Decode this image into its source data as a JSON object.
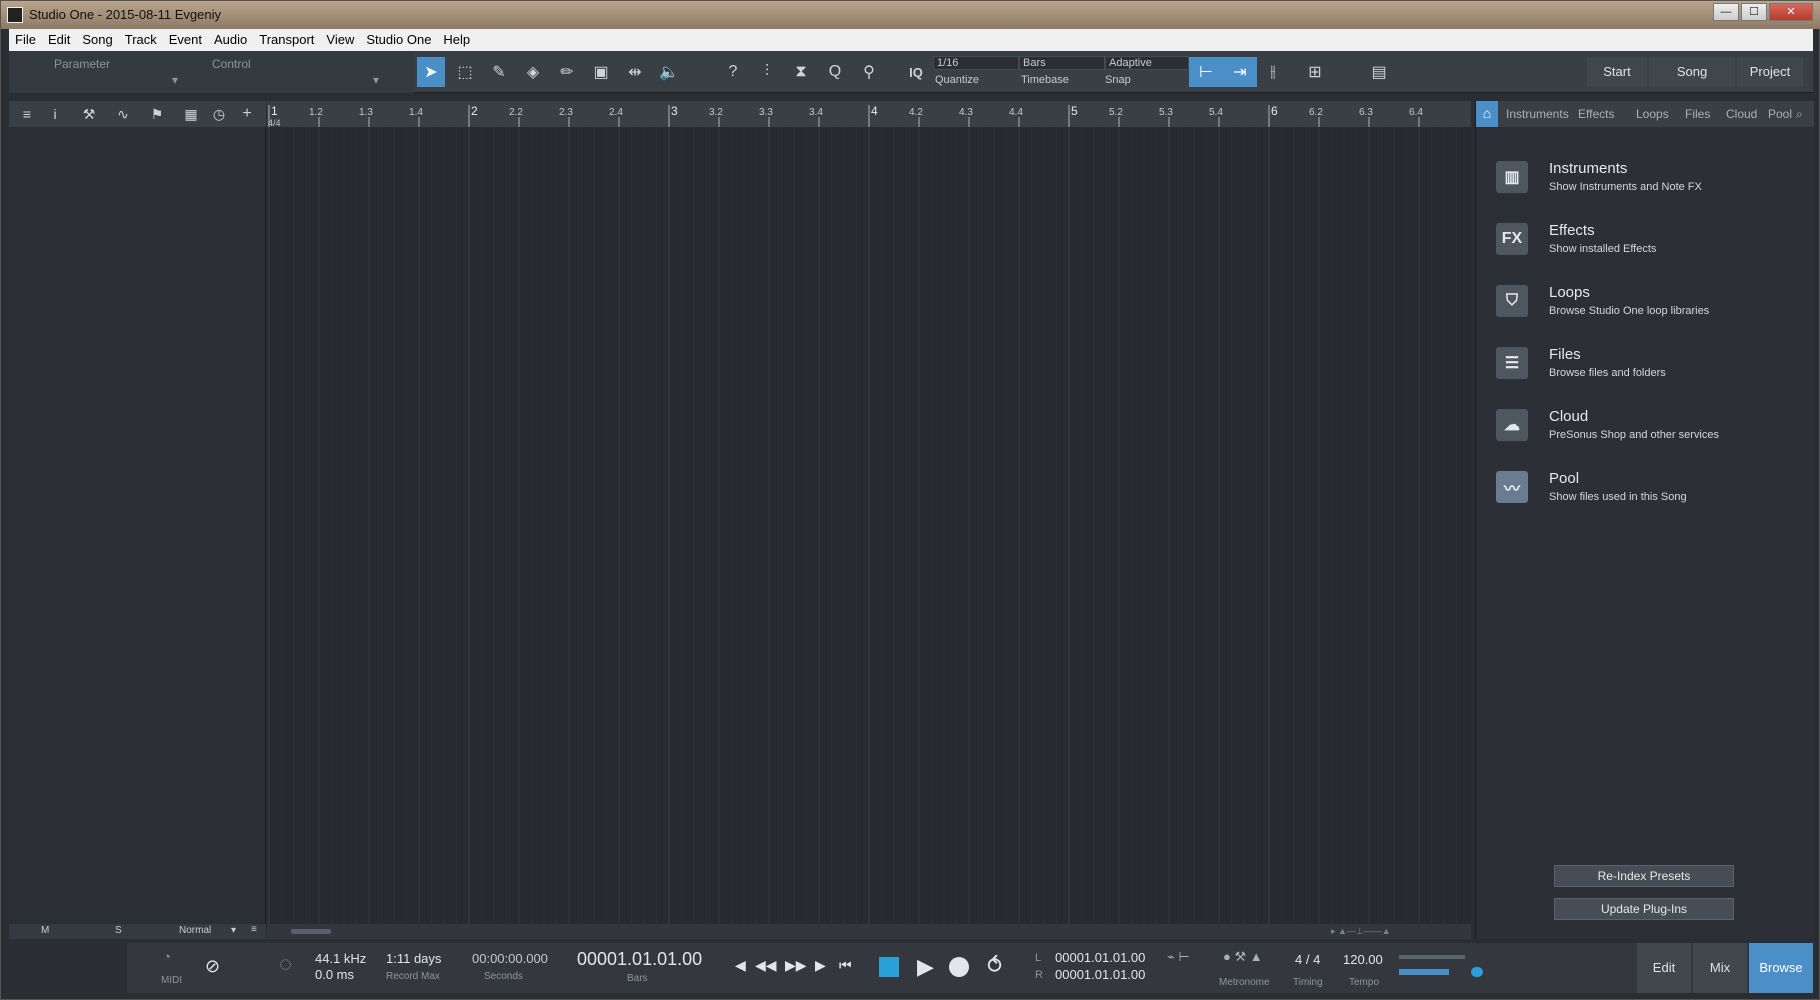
{
  "window": {
    "title": "Studio One - 2015-08-11 Evgeniy",
    "min": "—",
    "max": "☐",
    "close": "✕"
  },
  "menu": [
    "File",
    "Edit",
    "Song",
    "Track",
    "Event",
    "Audio",
    "Transport",
    "View",
    "Studio One",
    "Help"
  ],
  "toolbar": {
    "parameter_label": "Parameter",
    "control_label": "Control",
    "quantize_value": "1/16",
    "quantize_label": "Quantize",
    "timebase_value": "Bars",
    "timebase_label": "Timebase",
    "snap_value": "Adaptive",
    "snap_label": "Snap",
    "iq_label": "IQ",
    "nav": {
      "start": "Start",
      "song": "Song",
      "project": "Project"
    }
  },
  "ruler": {
    "first": "1",
    "signature": "4/4",
    "ticks": [
      "1.2",
      "1.3",
      "1.4",
      "2",
      "2.2",
      "2.3",
      "2.4",
      "3",
      "3.2",
      "3.3",
      "3.4",
      "4",
      "4.2",
      "4.3",
      "4.4",
      "5",
      "5.2",
      "5.3",
      "5.4",
      "6",
      "6.2",
      "6.3",
      "6.4"
    ]
  },
  "browser": {
    "tabs": [
      "Instruments",
      "Effects",
      "Loops",
      "Files",
      "Cloud",
      "Pool"
    ],
    "items": [
      {
        "name": "Instruments",
        "desc": "Show Instruments and Note FX",
        "icon": "piano-icon"
      },
      {
        "name": "Effects",
        "desc": "Show installed Effects",
        "icon": "fx-icon",
        "glyph": "FX"
      },
      {
        "name": "Loops",
        "desc": "Browse Studio One loop libraries",
        "icon": "loops-icon"
      },
      {
        "name": "Files",
        "desc": "Browse files and folders",
        "icon": "files-icon"
      },
      {
        "name": "Cloud",
        "desc": "PreSonus Shop and other services",
        "icon": "cloud-icon"
      },
      {
        "name": "Pool",
        "desc": "Show files used in this Song",
        "icon": "pool-icon"
      }
    ],
    "reindex": "Re-Index Presets",
    "update": "Update Plug-Ins"
  },
  "track_footer": {
    "m": "M",
    "s": "S",
    "mode": "Normal"
  },
  "transport": {
    "midi_label": "MIDI",
    "sample_rate": "44.1 kHz",
    "latency": "0.0 ms",
    "record_max_value": "1:11 days",
    "record_max_label": "Record Max",
    "seconds_value": "00:00:00.000",
    "seconds_label": "Seconds",
    "position": "00001.01.01.00",
    "position_label": "Bars",
    "loop_l_label": "L",
    "loop_l": "00001.01.01.00",
    "loop_r_label": "R",
    "loop_r": "00001.01.01.00",
    "metronome_label": "Metronome",
    "timing_value": "4 / 4",
    "timing_label": "Timing",
    "tempo_value": "120.00",
    "tempo_label": "Tempo",
    "views": {
      "edit": "Edit",
      "mix": "Mix",
      "browse": "Browse"
    }
  },
  "colors": {
    "accent": "#4a8fc7",
    "panel": "#2c3036",
    "arrange": "#272a2e"
  }
}
